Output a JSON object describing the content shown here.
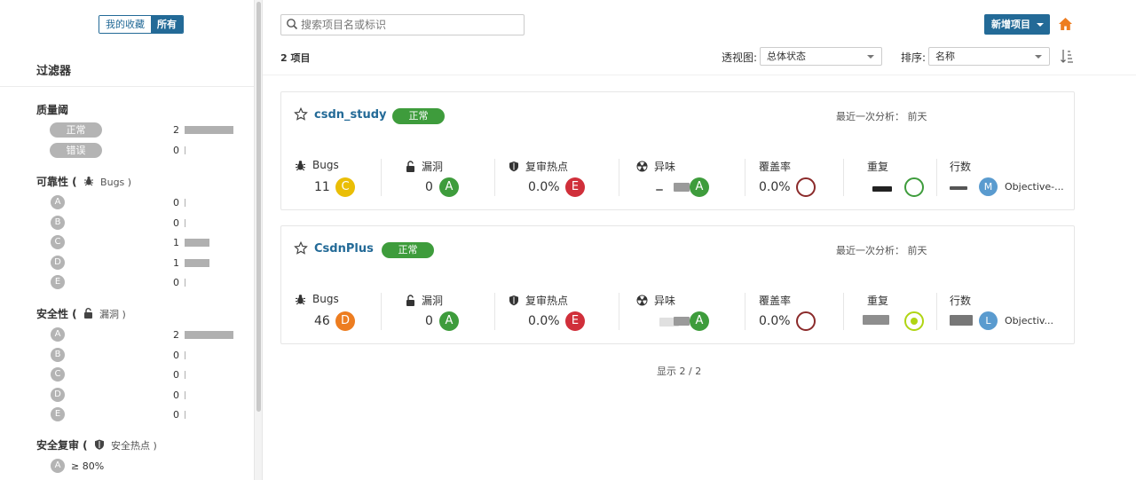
{
  "sidebar": {
    "toggle": {
      "favorites": "我的收藏",
      "all": "所有"
    },
    "filter_title": "过滤器",
    "quality_gate": {
      "title": "质量阈",
      "items": [
        {
          "label": "正常",
          "count": "2",
          "share": 1.0
        },
        {
          "label": "错误",
          "count": "0",
          "share": 0
        }
      ]
    },
    "reliability": {
      "title": "可靠性 (",
      "sub": "Bugs )",
      "items": [
        {
          "rating": "A",
          "count": "0",
          "share": 0
        },
        {
          "rating": "B",
          "count": "0",
          "share": 0
        },
        {
          "rating": "C",
          "count": "1",
          "share": 0.5
        },
        {
          "rating": "D",
          "count": "1",
          "share": 0.5
        },
        {
          "rating": "E",
          "count": "0",
          "share": 0
        }
      ]
    },
    "security": {
      "title": "安全性 (",
      "sub": "漏洞 )",
      "items": [
        {
          "rating": "A",
          "count": "2",
          "share": 1.0
        },
        {
          "rating": "B",
          "count": "0",
          "share": 0
        },
        {
          "rating": "C",
          "count": "0",
          "share": 0
        },
        {
          "rating": "D",
          "count": "0",
          "share": 0
        },
        {
          "rating": "E",
          "count": "0",
          "share": 0
        }
      ]
    },
    "security_review": {
      "title": "安全复审 (",
      "sub": "安全热点 )",
      "items": [
        {
          "rating": "A",
          "threshold": "≥ 80%"
        }
      ]
    }
  },
  "search": {
    "placeholder": "搜索项目名或标识"
  },
  "new_project_label": "新增项目",
  "project_count": "2 项目",
  "perspective": {
    "label": "透视图:",
    "value": "总体状态"
  },
  "sort": {
    "label": "排序:",
    "value": "名称"
  },
  "metric_labels": {
    "bugs": "Bugs",
    "vulnerabilities": "漏洞",
    "hotspots": "复审热点",
    "code_smells": "异味",
    "coverage": "覆盖率",
    "duplications": "重复",
    "lines": "行数"
  },
  "projects": [
    {
      "name": "csdn_study",
      "status": "正常",
      "last_analysis": "最近一次分析： 前天",
      "bugs": {
        "value": "11",
        "rating": "C"
      },
      "vulnerabilities": {
        "value": "0",
        "rating": "A"
      },
      "hotspots": {
        "value": "0.0%",
        "rating": "E"
      },
      "code_smells": {
        "rating": "A"
      },
      "coverage": {
        "value": "0.0%"
      },
      "lines": {
        "lang_initial": "M",
        "language": "Objective-..."
      }
    },
    {
      "name": "CsdnPlus",
      "status": "正常",
      "last_analysis": "最近一次分析： 前天",
      "bugs": {
        "value": "46",
        "rating": "D"
      },
      "vulnerabilities": {
        "value": "0",
        "rating": "A"
      },
      "hotspots": {
        "value": "0.0%",
        "rating": "E"
      },
      "code_smells": {
        "rating": "A"
      },
      "coverage": {
        "value": "0.0%"
      },
      "lines": {
        "lang_initial": "L",
        "language": "Objectiv..."
      }
    }
  ],
  "pagination": "显示 2 / 2",
  "colors": {
    "primary": "#236a97",
    "rating_A": "#3e9c3c",
    "rating_C": "#eabe06",
    "rating_D": "#ed7d20",
    "rating_E": "#d02f3a",
    "coverage_ring": "#8b2a2a",
    "dup_ring_1": "#3e9c3c",
    "dup_ring_2": "#b0d513",
    "home": "#ed7d20"
  }
}
